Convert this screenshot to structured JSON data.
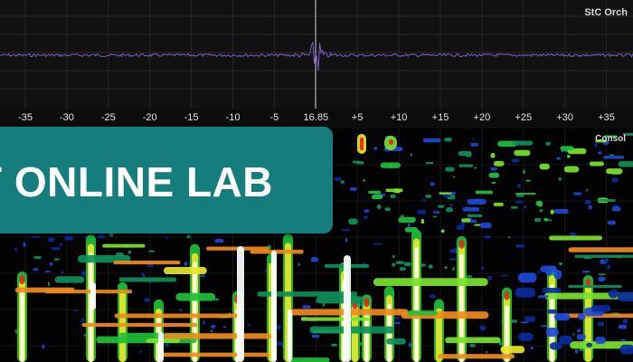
{
  "waveform": {
    "title": "StC Orch",
    "stroke_color": "#7a5cc4"
  },
  "ruler": {
    "ticks": [
      "-35",
      "-30",
      "-25",
      "-20",
      "-15",
      "-10",
      "-5",
      "16.85",
      "+5",
      "+10",
      "+15",
      "+20",
      "+25",
      "+30",
      "+35"
    ]
  },
  "spectrogram": {
    "title": "Consol"
  },
  "banner": {
    "text": "T ONLINE LAB",
    "color": "#167d7d"
  }
}
